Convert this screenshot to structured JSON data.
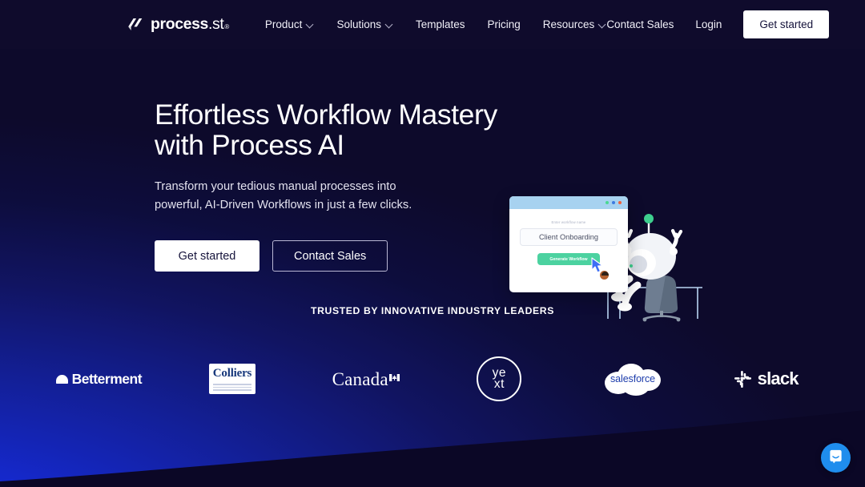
{
  "brand": {
    "name_bold": "process",
    "name_dot": ".",
    "name_light": "st",
    "trademark": "®",
    "logo_icon": "process-st-logo-icon"
  },
  "header": {
    "nav": [
      {
        "label": "Product",
        "has_dropdown": true,
        "icon": "chevron-down-icon"
      },
      {
        "label": "Solutions",
        "has_dropdown": true,
        "icon": "chevron-down-icon"
      },
      {
        "label": "Templates",
        "has_dropdown": false,
        "icon": ""
      },
      {
        "label": "Pricing",
        "has_dropdown": false,
        "icon": ""
      },
      {
        "label": "Resources",
        "has_dropdown": true,
        "icon": "chevron-down-icon"
      }
    ],
    "contact_sales": "Contact Sales",
    "login": "Login",
    "get_started": "Get started"
  },
  "hero": {
    "title": "Effortless Workflow Mastery\nwith Process AI",
    "subtitle": "Transform your tedious manual processes into\npowerful, AI-Driven Workflows in just a few clicks.",
    "cta_primary": "Get started",
    "cta_secondary": "Contact Sales"
  },
  "illustration": {
    "name": "ai-workflow-robot-illustration",
    "card_label": "Enter workflow name",
    "card_input_value": "Client Onboarding",
    "card_button": "Generate Workflow",
    "cursor_icon": "mouse-pointer-icon",
    "avatar_icon": "user-avatar-icon",
    "robot_icon": "robot-icon",
    "chair_icon": "office-chair-icon",
    "traffic_lights": [
      "#4ad991",
      "#3d7be0",
      "#f0603a"
    ]
  },
  "trust": {
    "heading": "TRUSTED BY INNOVATIVE INDUSTRY LEADERS",
    "logos": [
      {
        "name": "betterment-logo",
        "label": "Betterment"
      },
      {
        "name": "colliers-logo",
        "label": "Colliers"
      },
      {
        "name": "canada-logo",
        "label": "Canada"
      },
      {
        "name": "yext-logo",
        "label": "YEXT",
        "line1": "ye",
        "line2": "xt"
      },
      {
        "name": "salesforce-logo",
        "label": "salesforce"
      },
      {
        "name": "slack-logo",
        "label": "slack"
      }
    ]
  },
  "chat": {
    "name": "intercom-chat-launcher",
    "icon": "chat-bubble-icon"
  },
  "colors": {
    "bg_dark": "#0d0a2b",
    "bg_blue": "#1528c9",
    "accent_white": "#ffffff",
    "wave_dark": "#0b0726",
    "chat_blue": "#1f8ded",
    "illustration_green": "#3ecf8e",
    "illustration_header_blue": "#a7d2f0"
  }
}
